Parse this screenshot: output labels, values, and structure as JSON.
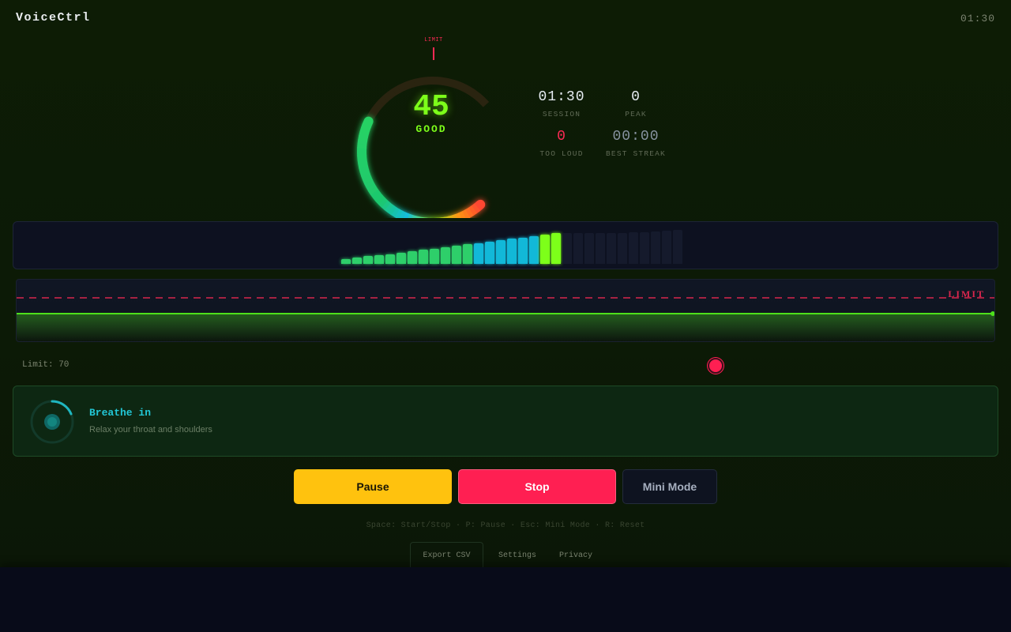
{
  "app": {
    "title": "VoiceCtrl",
    "clock": "01:30"
  },
  "gauge": {
    "value": "45",
    "status": "GOOD",
    "limit_label": "LIMIT",
    "level_fraction": 0.45,
    "limit_fraction": 0.7
  },
  "stats": {
    "session": {
      "value": "01:30",
      "label": "SESSION"
    },
    "peak": {
      "value": "0",
      "label": "PEAK"
    },
    "too_loud": {
      "value": "0",
      "label": "TOO LOUD"
    },
    "best_streak": {
      "value": "00:00",
      "label": "BEST STREAK"
    }
  },
  "meter": {
    "levels": [
      0.14,
      0.18,
      0.22,
      0.25,
      0.28,
      0.32,
      0.36,
      0.4,
      0.44,
      0.48,
      0.52,
      0.56,
      0.6,
      0.64,
      0.68,
      0.72,
      0.76,
      0.8,
      0.84,
      0.88,
      0.88,
      0.88,
      0.88,
      0.88,
      0.88,
      0.88,
      0.9,
      0.92,
      0.94,
      0.96,
      0.98
    ],
    "active_count": 20,
    "colors": {
      "low": "#2ecf6a",
      "mid": "#12b8d8",
      "high": "#7dff1a",
      "off": "#151a2c"
    }
  },
  "history": {
    "limit_label": "LIMIT",
    "line_color": "#4ee01b",
    "limit_color": "#ff2a55"
  },
  "limit": {
    "label": "Limit: 70",
    "value": 70
  },
  "breathe": {
    "title": "Breathe in",
    "subtitle": "Relax your throat and shoulders"
  },
  "controls": {
    "pause": "Pause",
    "stop": "Stop",
    "mini": "Mini Mode"
  },
  "shortcuts": "Space: Start/Stop · P: Pause · Esc: Mini Mode · R: Reset",
  "footer": {
    "export": "Export CSV",
    "settings": "Settings",
    "privacy": "Privacy"
  }
}
